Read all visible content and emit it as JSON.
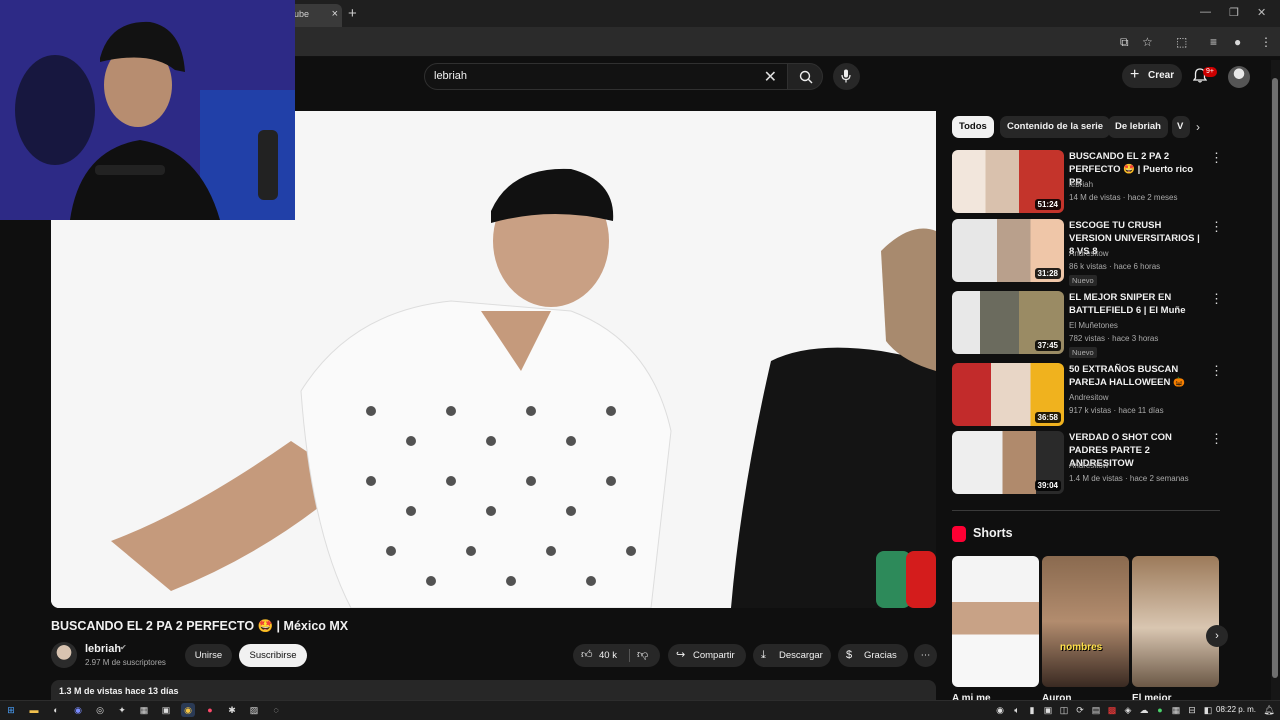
{
  "browser": {
    "tab_title": "ube",
    "tab_close": "×",
    "new_tab": "+"
  },
  "header": {
    "search_value": "lebriah",
    "create_label": "Crear",
    "notif_count": "9+"
  },
  "video": {
    "title": "BUSCANDO EL 2 PA 2 PERFECTO 🤩 | México MX",
    "channel": "lebriah",
    "subscribers": "2.97 M de suscriptores",
    "join_label": "Unirse",
    "subscribe_label": "Suscribirse",
    "likes": "40 k",
    "share_label": "Compartir",
    "download_label": "Descargar",
    "thanks_label": "Gracias",
    "views_date": "1.3 M de vistas  hace 13 días"
  },
  "chips": [
    "Todos",
    "Contenido de la serie",
    "De lebriah",
    "V"
  ],
  "related": [
    {
      "title": "BUSCANDO EL 2 PA 2 PERFECTO 🤩 | Puerto rico PR",
      "channel": "lebriah",
      "meta": "14 M de vistas · hace 2 meses",
      "duration": "51:24",
      "badge": ""
    },
    {
      "title": "ESCOGE TU CRUSH VERSION UNIVERSITARIOS | 8 VS 8",
      "channel": "Andresitow",
      "meta": "86 k vistas · hace 6 horas",
      "duration": "31:28",
      "badge": "Nuevo"
    },
    {
      "title": "EL MEJOR SNIPER EN BATTLEFIELD 6 | El Muñe",
      "channel": "El Muñetones",
      "meta": "782 vistas · hace 3 horas",
      "duration": "37:45",
      "badge": "Nuevo"
    },
    {
      "title": "50 EXTRAÑOS BUSCAN PAREJA HALLOWEEN 🎃",
      "channel": "Andresitow",
      "meta": "917 k vistas · hace 11 días",
      "duration": "36:58",
      "badge": ""
    },
    {
      "title": "VERDAD O SHOT CON PADRES PARTE 2 ANDRESITOW",
      "channel": "Andresitow",
      "meta": "1.4 M de vistas · hace 2 semanas",
      "duration": "39:04",
      "badge": ""
    }
  ],
  "shorts": {
    "label": "Shorts",
    "items": [
      {
        "caption": "A mi me",
        "overlay": ""
      },
      {
        "caption": "Auron",
        "overlay": "nombres"
      },
      {
        "caption": "El mejor",
        "overlay": ""
      }
    ]
  },
  "taskbar": {
    "time": "08:22 p. m."
  }
}
